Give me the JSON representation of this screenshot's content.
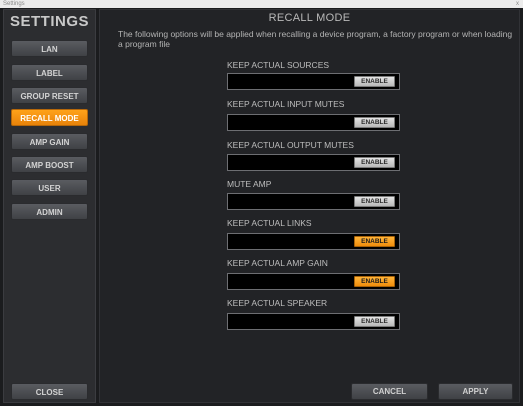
{
  "window": {
    "title": "Settings",
    "close_glyph": "x"
  },
  "sidebar": {
    "title": "SETTINGS",
    "items": [
      {
        "label": "LAN",
        "active": false
      },
      {
        "label": "LABEL",
        "active": false
      },
      {
        "label": "GROUP RESET",
        "active": false
      },
      {
        "label": "RECALL MODE",
        "active": true
      },
      {
        "label": "AMP GAIN",
        "active": false
      },
      {
        "label": "AMP BOOST",
        "active": false
      },
      {
        "label": "USER",
        "active": false
      },
      {
        "label": "ADMIN",
        "active": false
      }
    ],
    "close_label": "CLOSE"
  },
  "main": {
    "title": "RECALL MODE",
    "description": "The following options will be applied when recalling a device program, a factory program or when loading a program file",
    "options": [
      {
        "label": "KEEP ACTUAL SOURCES",
        "button": "ENABLE",
        "enabled": false
      },
      {
        "label": "KEEP ACTUAL INPUT MUTES",
        "button": "ENABLE",
        "enabled": false
      },
      {
        "label": "KEEP ACTUAL OUTPUT MUTES",
        "button": "ENABLE",
        "enabled": false
      },
      {
        "label": "MUTE AMP",
        "button": "ENABLE",
        "enabled": false
      },
      {
        "label": "KEEP ACTUAL LINKS",
        "button": "ENABLE",
        "enabled": true
      },
      {
        "label": "KEEP ACTUAL AMP GAIN",
        "button": "ENABLE",
        "enabled": true
      },
      {
        "label": "KEEP ACTUAL SPEAKER",
        "button": "ENABLE",
        "enabled": false
      }
    ],
    "cancel_label": "CANCEL",
    "apply_label": "APPLY"
  },
  "colors": {
    "accent": "#f5960f",
    "background": "#1b1c1e"
  }
}
